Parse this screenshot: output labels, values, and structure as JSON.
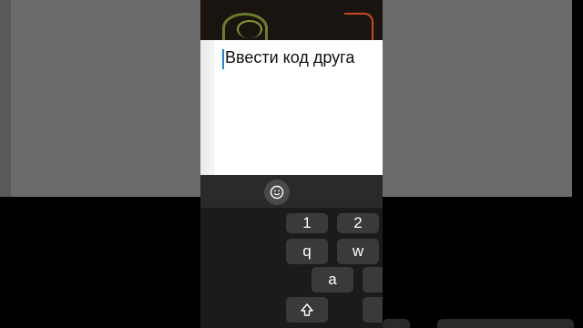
{
  "dialog": {
    "input_value": "Ввести код друга"
  },
  "keyboard": {
    "number_row": [
      "1",
      "2"
    ],
    "letter_row_1": [
      "q",
      "w"
    ],
    "letter_row_2": [
      "a"
    ],
    "shift_icon": "shift-arrow-icon",
    "emoji_icon": "smiley-icon"
  }
}
